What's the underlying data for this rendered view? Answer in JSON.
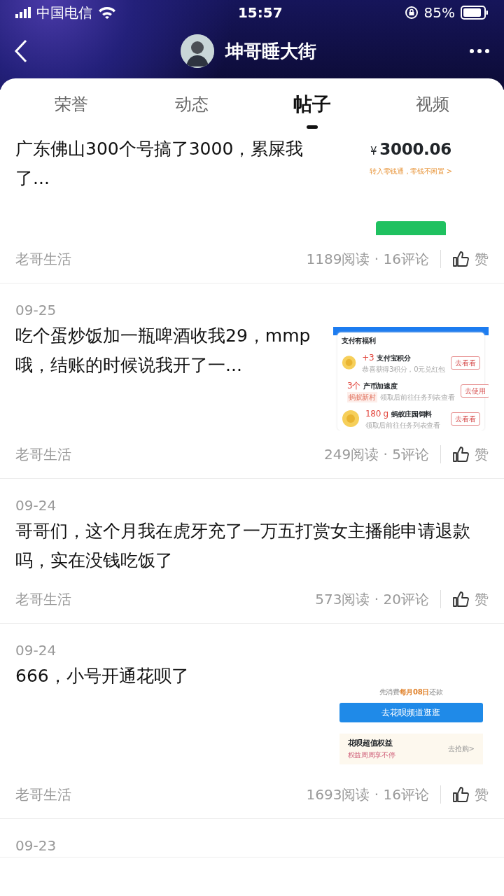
{
  "status_bar": {
    "carrier": "中国电信",
    "time": "15:57",
    "battery": "85%"
  },
  "header": {
    "title": "坤哥睡大街"
  },
  "tabs": [
    {
      "label": "荣誉",
      "selected": false
    },
    {
      "label": "动态",
      "selected": false
    },
    {
      "label": "帖子",
      "selected": true
    },
    {
      "label": "视频",
      "selected": false
    }
  ],
  "posts": [
    {
      "title": "广东佛山300个号搞了3000，累屎我了...",
      "thumbnail": {
        "kind": "balance",
        "symbol": "¥",
        "amount": "3000.06",
        "link": "转入零钱通，零钱不闲置 >"
      },
      "category": "老哥生活",
      "stats": "1189阅读 · 16评论",
      "like": "赞"
    },
    {
      "date": "09-25",
      "title": "吃个蛋炒饭加一瓶啤酒收我29，mmp哦，结账的时候说我开了一...",
      "thumbnail": {
        "kind": "rewards",
        "heading": "支付有福利",
        "items": [
          {
            "value": "+3",
            "name": "支付宝积分",
            "note": "恭喜获得3积分，0元兑红包",
            "button": "去看看"
          },
          {
            "value": "3个",
            "name": "产币加速度",
            "tag": "蚂蚁新村",
            "note": "领取后前往任务列表查看",
            "button": "去使用"
          },
          {
            "value": "180 g",
            "name": "蚂蚁庄园饲料",
            "note": "领取后前往任务列表查看",
            "button": "去看看"
          }
        ]
      },
      "category": "老哥生活",
      "stats": "249阅读 · 5评论",
      "like": "赞"
    },
    {
      "date": "09-24",
      "title": "哥哥们，这个月我在虎牙充了一万五打赏女主播能申请退款吗，实在没钱吃饭了",
      "category": "老哥生活",
      "stats": "573阅读 · 20评论",
      "like": "赞"
    },
    {
      "date": "09-24",
      "title": "666，小号开通花呗了",
      "thumbnail": {
        "kind": "huabei",
        "note": "先消费**每月08日**还款",
        "button": "去花呗频道逛逛",
        "promo_title": "花呗超值权益",
        "promo_subtitle": "权益周周享不停",
        "promo_link": "去抢购>"
      },
      "category": "老哥生活",
      "stats": "1693阅读 · 16评论",
      "like": "赞"
    },
    {
      "date": "09-23"
    }
  ]
}
